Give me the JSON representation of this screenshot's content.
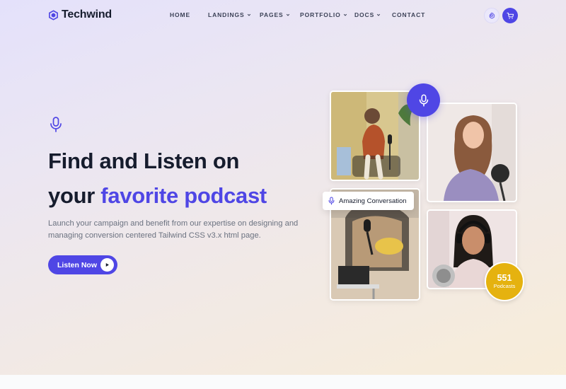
{
  "brand": {
    "name": "Techwind",
    "color": "#4f46e5"
  },
  "nav": {
    "items": [
      {
        "label": "HOME",
        "dropdown": false
      },
      {
        "label": "LANDINGS",
        "dropdown": true
      },
      {
        "label": "PAGES",
        "dropdown": true
      },
      {
        "label": "PORTFOLIO",
        "dropdown": true
      },
      {
        "label": "DOCS",
        "dropdown": true
      },
      {
        "label": "CONTACT",
        "dropdown": false
      }
    ],
    "icons": [
      "gear-icon",
      "cart-icon"
    ]
  },
  "hero": {
    "icon": "microphone-icon",
    "title_line1": "Find and Listen on",
    "title_line2_prefix": "your ",
    "title_line2_accent": "favorite podcast",
    "description": "Launch your campaign and benefit from our expertise on designing and managing conversion centered Tailwind CSS v3.x html page.",
    "cta_label": "Listen Now",
    "cta_icon": "play-icon"
  },
  "gallery": {
    "floating_icon": "microphone-icon",
    "card_label": "Amazing Conversation",
    "badge_number": "551",
    "badge_label": "Podcasts",
    "badge_color": "#e5b20f"
  }
}
